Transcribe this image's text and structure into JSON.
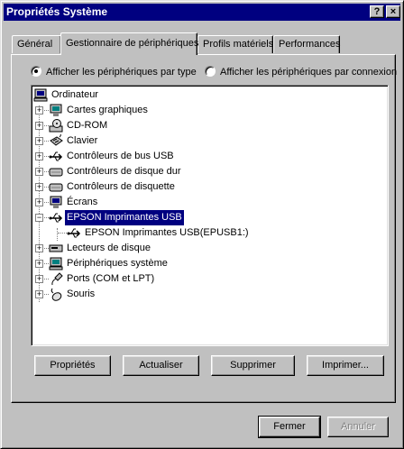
{
  "window": {
    "title": "Propriétés Système",
    "help_label": "?",
    "close_label": "×"
  },
  "tabs": [
    {
      "label": "Général"
    },
    {
      "label": "Gestionnaire de périphériques"
    },
    {
      "label": "Profils matériels"
    },
    {
      "label": "Performances"
    }
  ],
  "view_options": {
    "by_type": {
      "label": "Afficher les périphériques par type",
      "checked": true
    },
    "by_connection": {
      "label": "Afficher les périphériques par connexion",
      "checked": false
    }
  },
  "tree": {
    "root": "Ordinateur",
    "items": [
      {
        "label": "Cartes graphiques",
        "icon": "display-adapter-icon"
      },
      {
        "label": "CD-ROM",
        "icon": "cdrom-icon"
      },
      {
        "label": "Clavier",
        "icon": "keyboard-icon"
      },
      {
        "label": "Contrôleurs de bus USB",
        "icon": "usb-icon"
      },
      {
        "label": "Contrôleurs de disque dur",
        "icon": "disk-controller-icon"
      },
      {
        "label": "Contrôleurs de disquette",
        "icon": "floppy-controller-icon"
      },
      {
        "label": "Écrans",
        "icon": "monitor-icon"
      },
      {
        "label": "EPSON Imprimantes USB",
        "icon": "usb-icon",
        "expanded": true,
        "selected": true
      },
      {
        "label": "EPSON Imprimantes USB(EPUSB1:)",
        "icon": "usb-icon",
        "child": true
      },
      {
        "label": "Lecteurs de disque",
        "icon": "disk-drive-icon"
      },
      {
        "label": "Périphériques système",
        "icon": "system-device-icon"
      },
      {
        "label": "Ports (COM et LPT)",
        "icon": "port-icon"
      },
      {
        "label": "Souris",
        "icon": "mouse-icon"
      }
    ]
  },
  "buttons": {
    "properties": "Propriétés",
    "refresh": "Actualiser",
    "remove": "Supprimer",
    "print": "Imprimer..."
  },
  "footer": {
    "close": "Fermer",
    "cancel": "Annuler"
  },
  "colors": {
    "face": "#c0c0c0",
    "title_bar": "#000080",
    "selection": "#000080"
  }
}
